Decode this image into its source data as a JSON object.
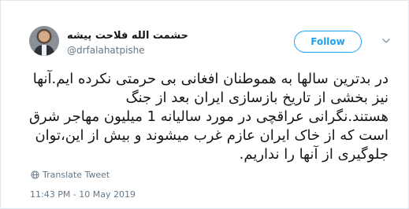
{
  "author": {
    "display_name": "حشمت الله فلاحت پیشه",
    "handle": "@drfalahatpishe"
  },
  "follow_button": {
    "label": "Follow"
  },
  "tweet": {
    "lines": [
      "در بدترین سالها به هموطنان افغانی بی حرمتی نکرده ایم.آنها",
      "نیز بخشی از تاریخ  بازسازی ایران بعد از جنگ",
      "هستند.نگرانی عراقچی در مورد سالیانه 1 میلیون مهاجر شرق",
      "است که از خاک ایران عازم غرب میشوند و بیش از این،توان",
      "جلوگیری از آنها را نداریم."
    ]
  },
  "translate": {
    "label": "Translate Tweet"
  },
  "timestamp": "11:43 PM - 10 May 2019",
  "colors": {
    "accent": "#1da1f2",
    "secondary_text": "#657786",
    "border": "#e1e8ed"
  }
}
